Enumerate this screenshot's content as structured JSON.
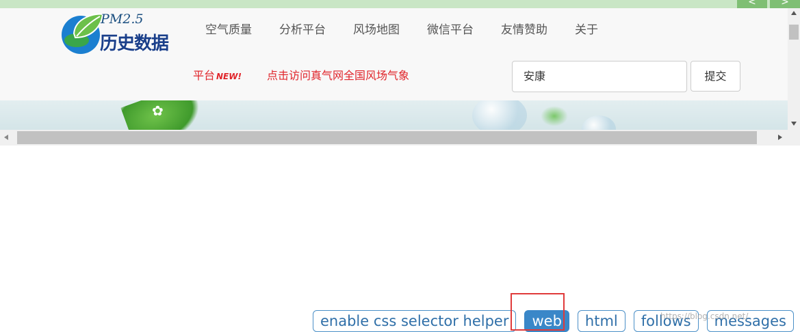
{
  "top_bar": {
    "prev_label": "<",
    "next_label": ">"
  },
  "site": {
    "logo_sup": "PM2.5",
    "logo_title": "历史数据",
    "menu": [
      {
        "label": "空气质量"
      },
      {
        "label": "分析平台"
      },
      {
        "label": "风场地图"
      },
      {
        "label": "微信平台"
      },
      {
        "label": "友情赞助"
      },
      {
        "label": "关于"
      }
    ],
    "promo_label": "平台",
    "promo_badge": "NEW!",
    "promo_link": "点击访问真气网全国风场气象",
    "search_value": "安康",
    "submit_label": "提交"
  },
  "toolbar": {
    "items": [
      {
        "label": "enable css selector helper"
      },
      {
        "label": "web"
      },
      {
        "label": "html"
      },
      {
        "label": "follows"
      },
      {
        "label": "messages"
      }
    ]
  },
  "watermark": "https://blog.csdn.net/"
}
